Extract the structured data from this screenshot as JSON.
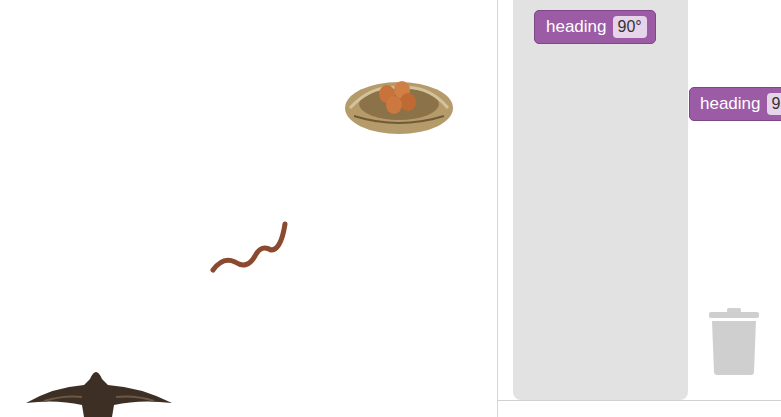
{
  "toolbox": {
    "blocks": [
      {
        "label": "heading",
        "value": "90°"
      }
    ]
  },
  "workspace": {
    "blocks": [
      {
        "label": "heading",
        "value": "9"
      }
    ]
  }
}
